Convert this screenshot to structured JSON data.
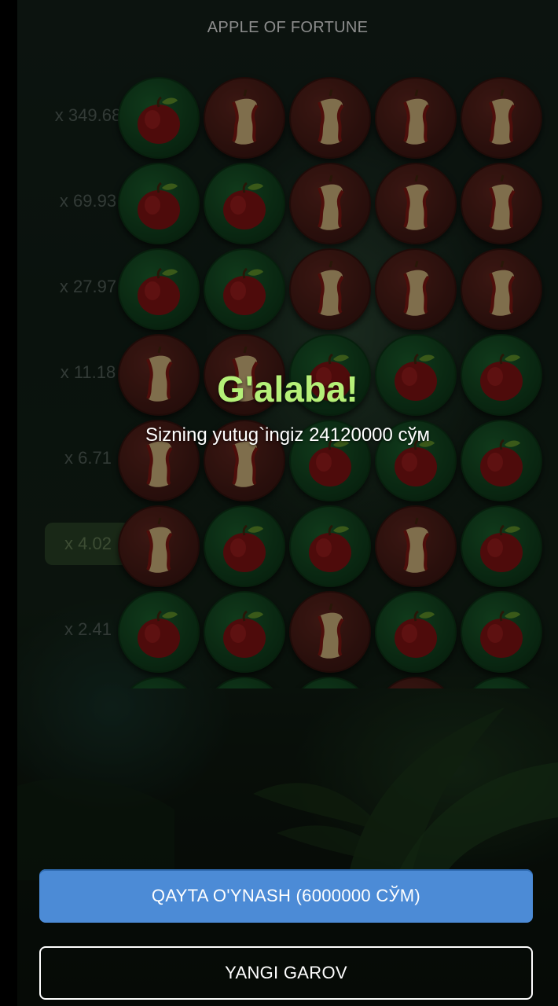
{
  "game": {
    "title": "APPLE OF FORTUNE"
  },
  "multipliers": [
    {
      "label": "x 349.68",
      "active": false
    },
    {
      "label": "x 69.93",
      "active": false
    },
    {
      "label": "x 27.97",
      "active": false
    },
    {
      "label": "x 11.18",
      "active": false
    },
    {
      "label": "x 6.71",
      "active": false
    },
    {
      "label": "x 4.02",
      "active": true
    },
    {
      "label": "x 2.41",
      "active": false
    }
  ],
  "board": [
    [
      "apple",
      "core",
      "core",
      "core",
      "core"
    ],
    [
      "apple",
      "apple",
      "core",
      "core",
      "core"
    ],
    [
      "apple",
      "apple",
      "core",
      "core",
      "core"
    ],
    [
      "core",
      "core",
      "apple",
      "apple",
      "apple"
    ],
    [
      "core",
      "core",
      "apple",
      "apple",
      "apple"
    ],
    [
      "core",
      "apple",
      "apple",
      "core",
      "apple"
    ],
    [
      "apple",
      "apple",
      "core",
      "apple",
      "apple"
    ],
    [
      "apple",
      "apple",
      "apple",
      "core",
      "apple"
    ]
  ],
  "result": {
    "title": "G'alaba!",
    "message": "Sizning yutug`ingiz 24120000 сўм"
  },
  "actions": {
    "play_again": "QAYTA O'YNASH (6000000 СЎМ)",
    "new_bet": "YANGI GAROV"
  },
  "colors": {
    "win_title": "#b5f078",
    "primary_button": "#4c8bd6"
  }
}
